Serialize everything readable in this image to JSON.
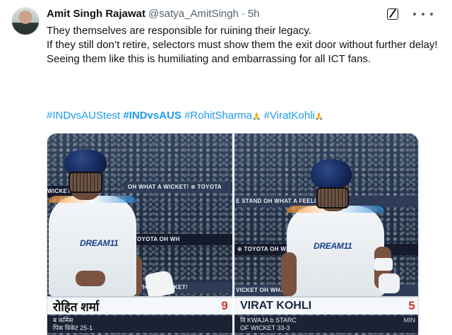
{
  "tweet": {
    "author_name": "Amit Singh Rajawat",
    "handle": "@satya_AmitSingh",
    "separator": "·",
    "time": "5h",
    "lines": [
      "They themselves are responsible for ruining their legacy.",
      "If they still don’t retire, selectors must show them the exit door without further delay!",
      "",
      "Seeing them like this is humiliating and embarrassing for all ICT fans."
    ],
    "hashtags": [
      {
        "text": "#INDvsAUStest",
        "bold": false
      },
      {
        "text": "#INDvsAUS",
        "bold": true
      },
      {
        "text": "#RohitSharma",
        "bold": false,
        "emoji": "🙏"
      },
      {
        "text": "#ViratKohli",
        "bold": false,
        "emoji": "🙏"
      }
    ]
  },
  "icons": {
    "grok": "grok-icon",
    "more": "more-icon",
    "avatar": "avatar"
  },
  "media": {
    "left": {
      "ad_top_left": "WICKET",
      "ad_top": "OH WHAT A WICKET!  ⊕ TOYOTA",
      "ad_mid": "TOYOTA   OH WH",
      "ad_low": "OTA   WHAT A WICKET!",
      "shirt_logo": "DREAM11",
      "player_name": "रोहित शर्मा",
      "score": "9",
      "caption_line1": "ब कमिंस",
      "caption_line2": "पिक विकेट 25-1"
    },
    "right": {
      "ad_top": "E STAND   OH WHAT A FEELING  ⊕ TOY",
      "ad_mid": "⊕ TOYOTA   OH WHAT A   CRICKET",
      "ad_low": "VICKET OH WHAT A   ⊕ TOYO",
      "shirt_logo": "DREAM11",
      "player_name": "VIRAT KOHLI",
      "score": "5",
      "caption_line1": "वि KWAJA b STARC",
      "caption_line2": "OF WICKET 33-3",
      "caption_right": "MIN"
    }
  },
  "colors": {
    "link": "#1d9bf0",
    "text": "#0f1419",
    "muted": "#536471",
    "score_red": "#d0342c"
  }
}
